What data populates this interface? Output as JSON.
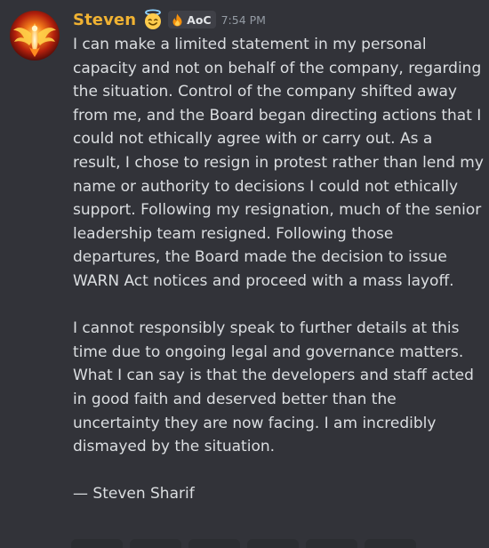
{
  "message": {
    "username": "Steven",
    "username_color": "#f0b232",
    "emoji_icon": "smiling-face-with-halo-emoji",
    "tag": {
      "icon": "flame-icon",
      "label": "AoC"
    },
    "timestamp": "7:54 PM",
    "paragraphs": [
      "I can make a limited statement in my personal capacity and not on behalf of the company, regarding the situation. Control of the company shifted away from me, and the Board began directing actions that I could not ethically agree with or carry out. As a result, I chose to resign in protest rather than lend my name or authority to decisions I could not ethically support. Following my resignation, much of the senior leadership team resigned. Following those departures, the Board made the decision to issue WARN Act notices and proceed with a mass layoff.",
      "I cannot responsibly speak to further details at this time due to ongoing legal and governance matters. What I can say is that the developers and staff acted in good faith and deserved better than the uncertainty they are now facing. I am incredibly dismayed by the situation.",
      "— Steven Sharif"
    ]
  },
  "colors": {
    "background": "#323339",
    "text": "#dbdee1",
    "muted": "#949ba4",
    "tag_bg": "#3f4047"
  }
}
